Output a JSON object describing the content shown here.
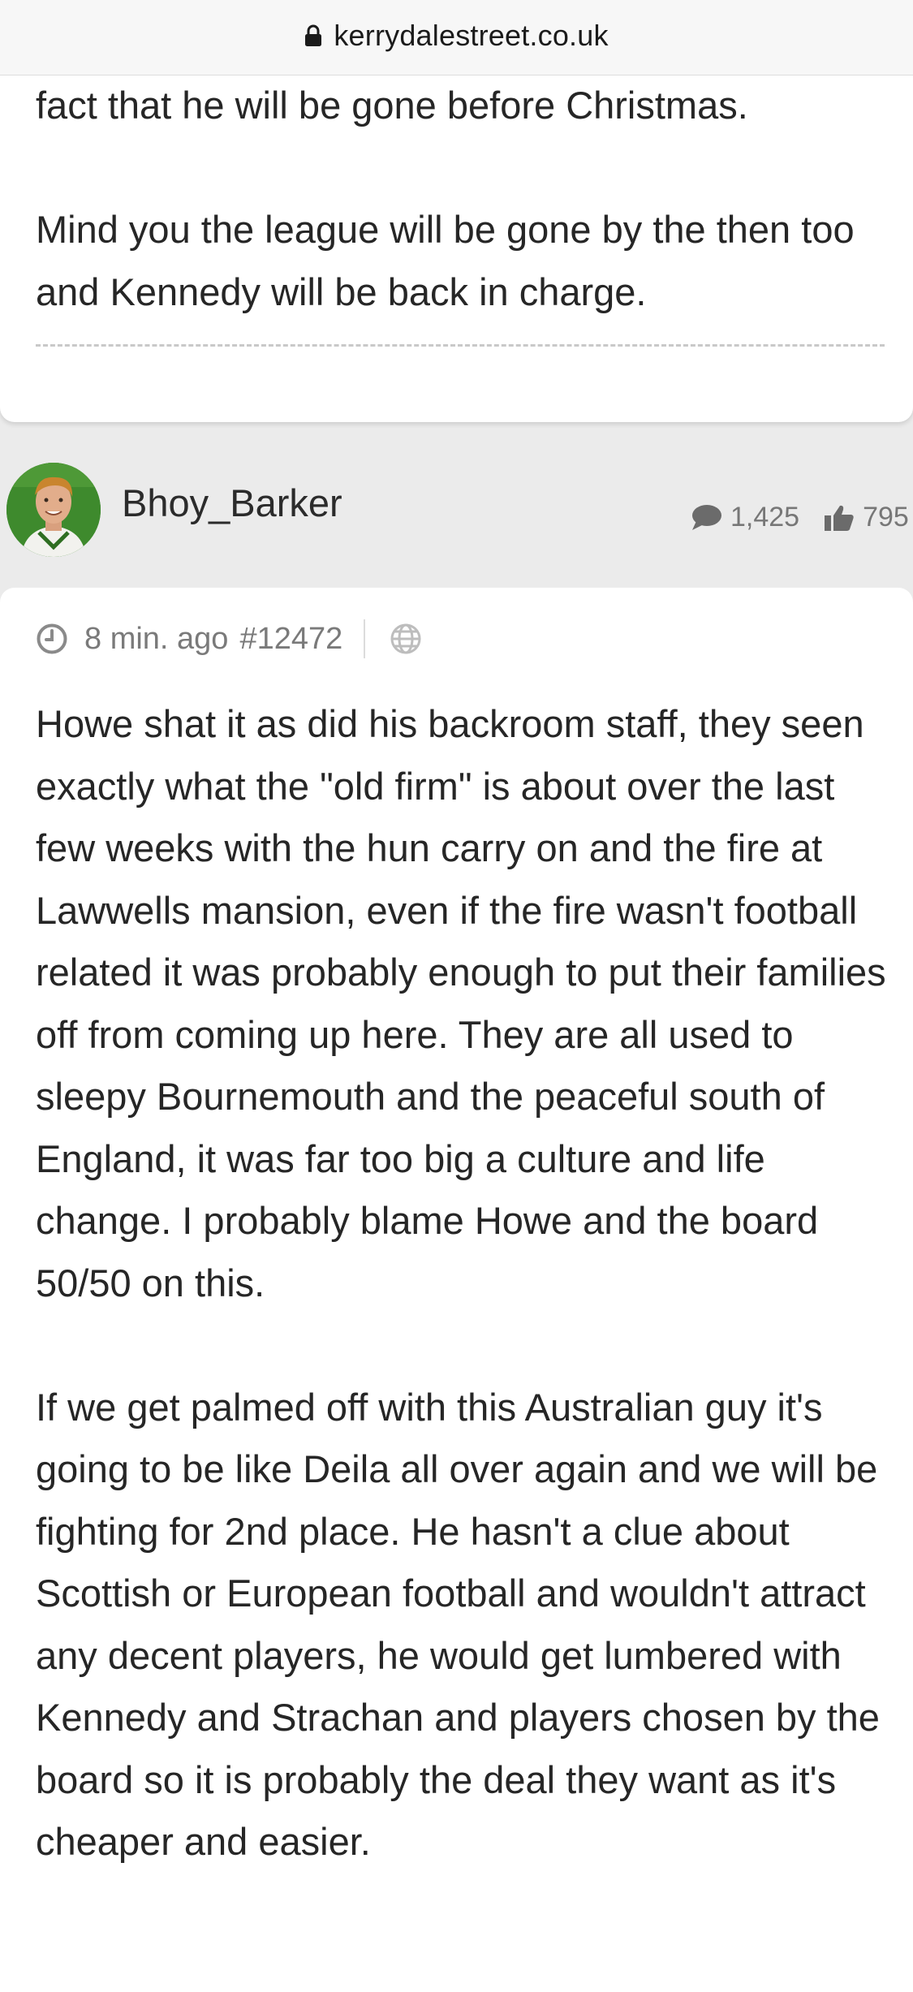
{
  "browser": {
    "url": "kerrydalestreet.co.uk"
  },
  "previous_post": {
    "text": "fact that he will be gone before Christmas.\n\nMind you the league will be gone by the then too and Kennedy will be back in charge."
  },
  "post": {
    "author": "Bhoy_Barker",
    "comment_count": "1,425",
    "like_count": "795",
    "time": "8 min. ago",
    "number": "#12472",
    "text": "Howe shat it as did his backroom staff, they seen exactly what the \"old firm\" is about over the last few weeks with the hun carry on and the fire at Lawwells mansion, even if the fire wasn't football related it was probably enough to put their families off from coming up here. They are all used to sleepy Bournemouth and the peaceful south of England, it was far too big a culture and life change. I probably blame Howe and the board 50/50 on this.\n\nIf we get palmed off with this Australian guy it's going to be like Deila all over again and we will be fighting for 2nd place. He hasn't a clue about Scottish or European football and wouldn't attract any decent players, he would get lumbered with Kennedy and Strachan and players chosen by the board so it is probably the deal they want as it's cheaper and easier."
  },
  "icons": {
    "lock": "lock-icon",
    "avatar": "avatar",
    "comments": "speech-bubble-icon",
    "likes": "thumbs-up-icon",
    "time": "clock-icon",
    "visibility": "globe-icon"
  }
}
